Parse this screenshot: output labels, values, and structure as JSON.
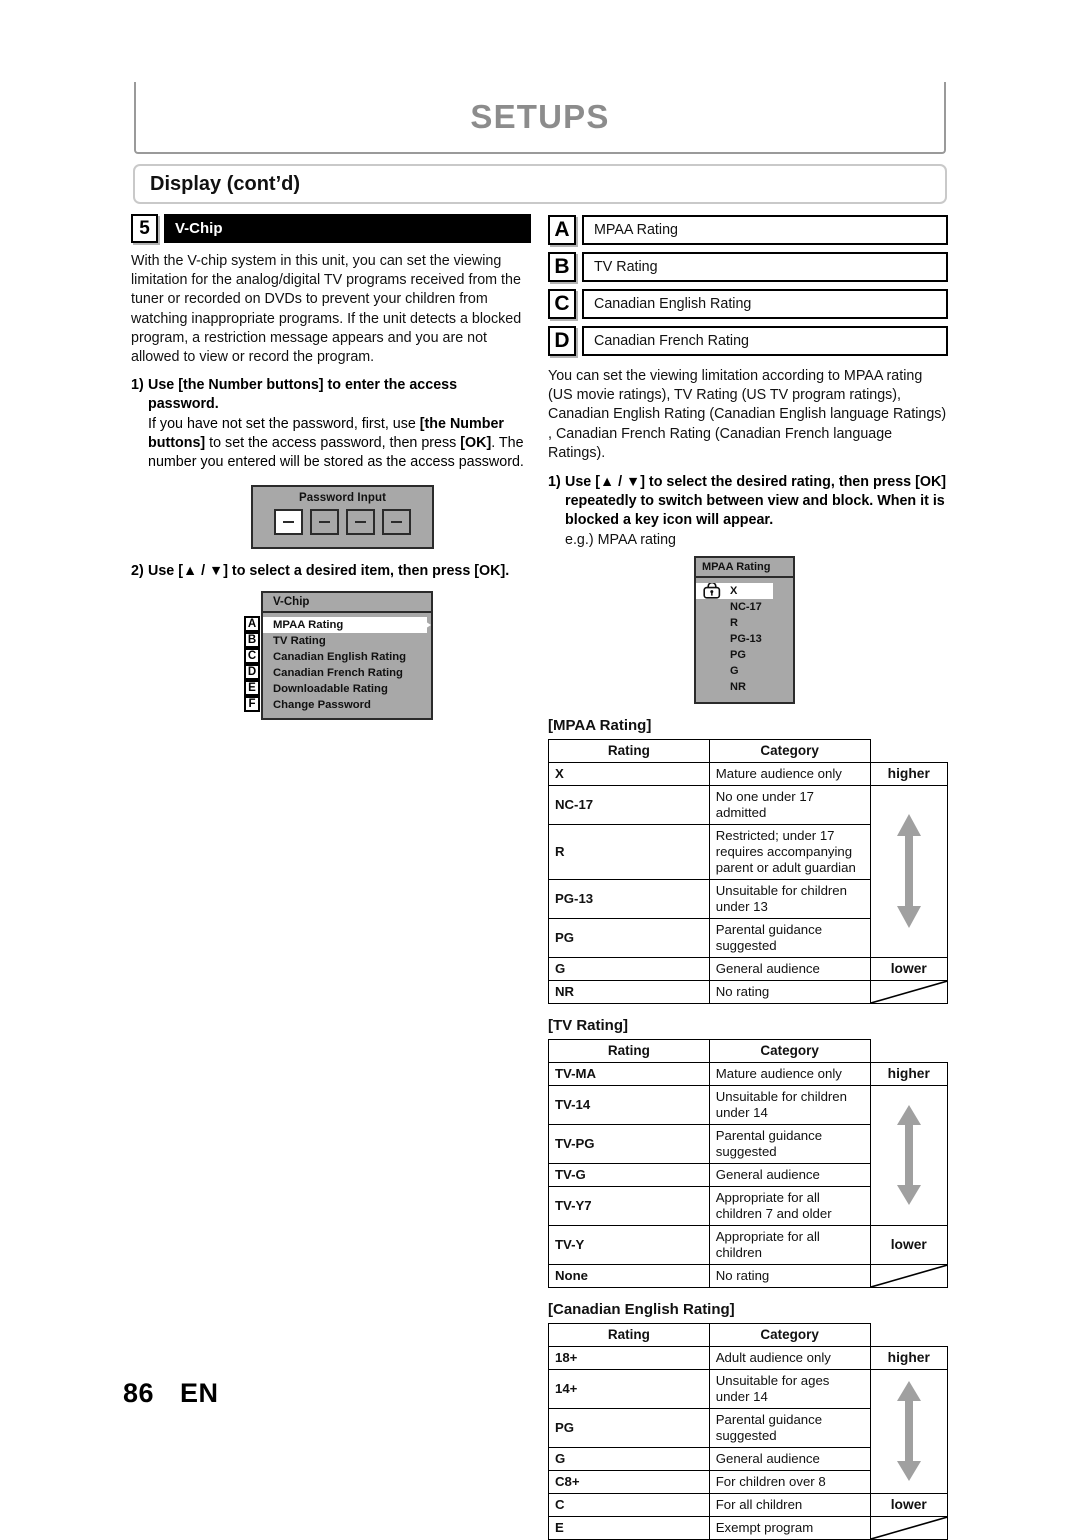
{
  "header": {
    "section_title": "SETUPS",
    "subsection_title": "Display (cont’d)"
  },
  "left_column": {
    "step": {
      "number": "5",
      "label": "V-Chip"
    },
    "intro_paragraph": "With the V-chip system in this unit, you can set the viewing limitation for the analog/digital TV programs received from the tuner or recorded on DVDs to prevent your children from watching inappropriate programs. If the unit detects a blocked program, a restriction message appears and you are not allowed to view or record the program.",
    "step1": {
      "marker": "1)",
      "bold_lead_part1": "Use ",
      "bold_lead_bracket": "[the Number buttons]",
      "bold_lead_part2": " to enter the access password.",
      "sub_text_1": "If you have not set the password, first, use ",
      "sub_bold_1": "[the Number buttons]",
      "sub_text_2": " to set the access password, then press ",
      "sub_bold_2": "[OK]",
      "sub_text_3": ". The number you entered will be stored as the access password."
    },
    "password_osd": {
      "title": "Password Input",
      "digits": [
        "—",
        "—",
        "—",
        "—"
      ],
      "active_index": 0
    },
    "step2": {
      "marker": "2)",
      "text_part1": "Use [",
      "up_arrow": "▲",
      "sep": " / ",
      "down_arrow": "▼",
      "text_part2": "] to select a desired item, then press [OK]."
    },
    "vchip_osd": {
      "title": "V-Chip",
      "items": [
        {
          "tag": "A",
          "label": "MPAA Rating",
          "selected": true
        },
        {
          "tag": "B",
          "label": "TV Rating",
          "selected": false
        },
        {
          "tag": "C",
          "label": "Canadian English Rating",
          "selected": false
        },
        {
          "tag": "D",
          "label": "Canadian French Rating",
          "selected": false
        },
        {
          "tag": "E",
          "label": "Downloadable Rating",
          "selected": false
        },
        {
          "tag": "F",
          "label": "Change Password",
          "selected": false
        }
      ]
    }
  },
  "right_column": {
    "letter_boxes": [
      {
        "letter": "A",
        "label": "MPAA Rating"
      },
      {
        "letter": "B",
        "label": "TV Rating"
      },
      {
        "letter": "C",
        "label": "Canadian English Rating"
      },
      {
        "letter": "D",
        "label": "Canadian French Rating"
      }
    ],
    "description_paragraph": "You can set the viewing limitation according to MPAA rating (US movie ratings), TV Rating (US TV program ratings), Canadian English Rating (Canadian English language Ratings) , Canadian French Rating (Canadian French language Ratings).",
    "step1": {
      "marker": "1)",
      "text_part1": "Use [",
      "up_arrow": "▲",
      "sep": " / ",
      "down_arrow": "▼",
      "text_part2": "] to select the desired rating, then press [OK] repeatedly to switch between view and block. When it is blocked a key icon will appear."
    },
    "example_caption": "e.g.) MPAA rating",
    "mpaa_osd": {
      "title": "MPAA Rating",
      "lock_icon": "lock-icon",
      "items": [
        {
          "label": "X",
          "selected": true,
          "locked": true
        },
        {
          "label": "NC-17",
          "selected": false,
          "locked": false
        },
        {
          "label": "R",
          "selected": false,
          "locked": false
        },
        {
          "label": "PG-13",
          "selected": false,
          "locked": false
        },
        {
          "label": "PG",
          "selected": false,
          "locked": false
        },
        {
          "label": "G",
          "selected": false,
          "locked": false
        },
        {
          "label": "NR",
          "selected": false,
          "locked": false
        }
      ]
    },
    "tables": [
      {
        "caption": "[MPAA Rating]",
        "columns": [
          "Rating",
          "Category"
        ],
        "higher_label": "higher",
        "lower_label": "lower",
        "rows": [
          {
            "rating": "X",
            "category": "Mature audience only"
          },
          {
            "rating": "NC-17",
            "category": "No one under 17 admitted"
          },
          {
            "rating": "R",
            "category": "Restricted; under 17 requires accompanying parent or adult guardian"
          },
          {
            "rating": "PG-13",
            "category": "Unsuitable for children under 13"
          },
          {
            "rating": "PG",
            "category": "Parental guidance suggested"
          },
          {
            "rating": "G",
            "category": "General audience"
          },
          {
            "rating": "NR",
            "category": "No rating"
          }
        ]
      },
      {
        "caption": "[TV Rating]",
        "columns": [
          "Rating",
          "Category"
        ],
        "higher_label": "higher",
        "lower_label": "lower",
        "rows": [
          {
            "rating": "TV-MA",
            "category": "Mature audience only"
          },
          {
            "rating": "TV-14",
            "category": "Unsuitable for children under 14"
          },
          {
            "rating": "TV-PG",
            "category": "Parental guidance suggested"
          },
          {
            "rating": "TV-G",
            "category": "General audience"
          },
          {
            "rating": "TV-Y7",
            "category": "Appropriate for all children 7 and older"
          },
          {
            "rating": "TV-Y",
            "category": "Appropriate for all children"
          },
          {
            "rating": "None",
            "category": "No rating"
          }
        ]
      },
      {
        "caption": "[Canadian English Rating]",
        "columns": [
          "Rating",
          "Category"
        ],
        "higher_label": "higher",
        "lower_label": "lower",
        "rows": [
          {
            "rating": "18+",
            "category": "Adult audience only"
          },
          {
            "rating": "14+",
            "category": "Unsuitable for ages under 14"
          },
          {
            "rating": "PG",
            "category": "Parental guidance suggested"
          },
          {
            "rating": "G",
            "category": "General audience"
          },
          {
            "rating": "C8+",
            "category": "For children over 8"
          },
          {
            "rating": "C",
            "category": "For all children"
          },
          {
            "rating": "E",
            "category": "Exempt program"
          }
        ]
      }
    ]
  },
  "footer": {
    "page_number": "86",
    "language_code": "EN"
  }
}
